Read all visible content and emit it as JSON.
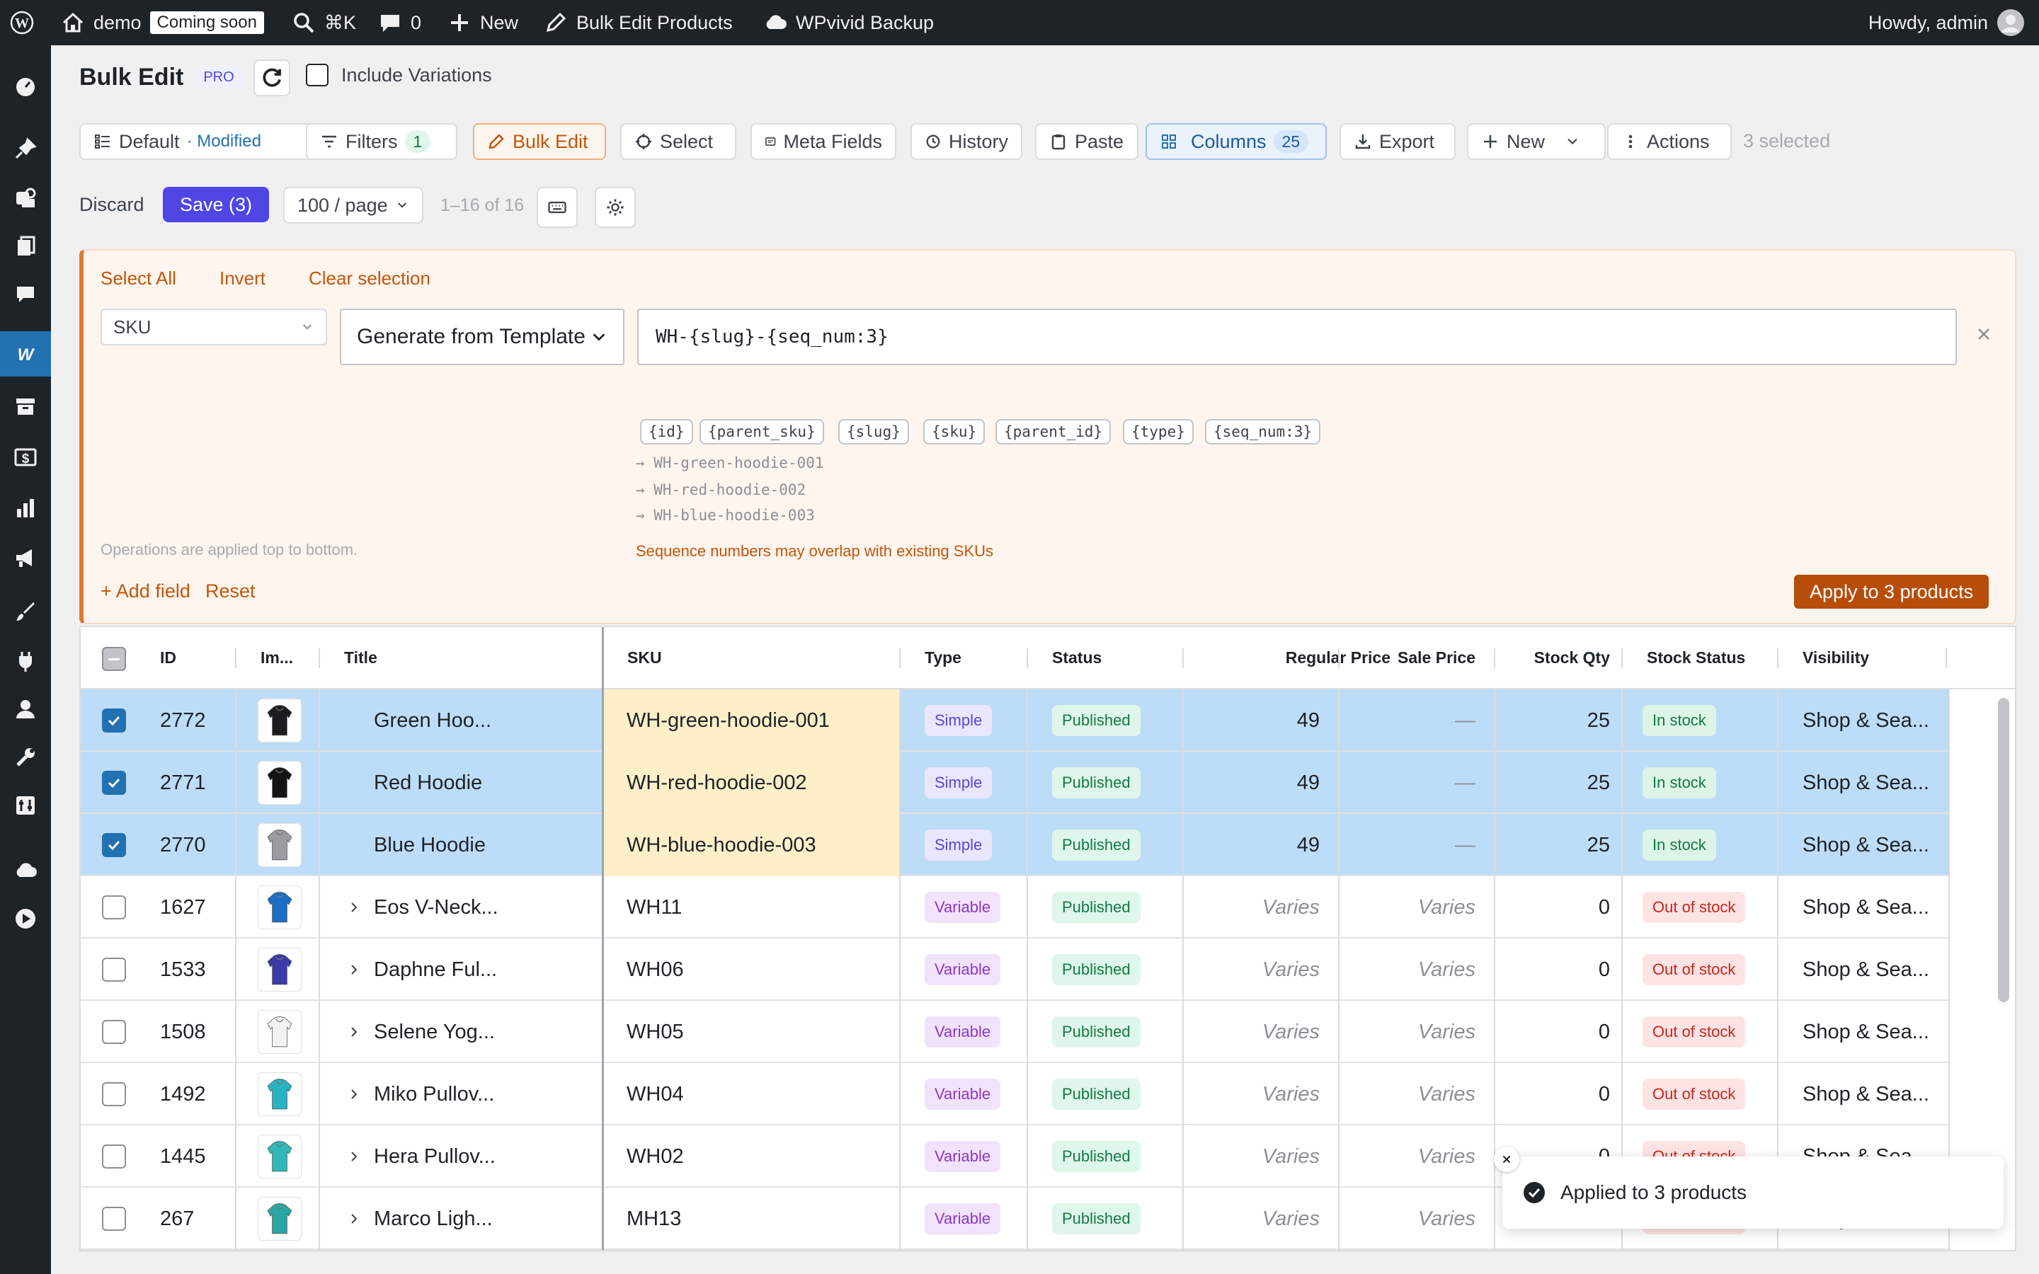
{
  "adminbar": {
    "site_name": "demo",
    "coming_soon": "Coming soon",
    "search_shortcut": "⌘K",
    "comments_count": "0",
    "new_label": "New",
    "bulk_edit_link": "Bulk Edit Products",
    "backup_link": "WPvivid Backup",
    "howdy": "Howdy, admin"
  },
  "header": {
    "title": "Bulk Edit",
    "pro_badge": "PRO",
    "include_variations": "Include Variations"
  },
  "toolbar": {
    "view_label": "Default",
    "view_modified": "· Modified",
    "filters_label": "Filters",
    "filters_count": "1",
    "bulk_edit_label": "Bulk Edit",
    "select_label": "Select",
    "meta_fields_label": "Meta Fields",
    "history_label": "History",
    "paste_label": "Paste",
    "columns_label": "Columns",
    "columns_count": "25",
    "export_label": "Export",
    "new_label": "New",
    "actions_label": "Actions",
    "selected_text": "3 selected"
  },
  "toolbar2": {
    "discard_label": "Discard",
    "save_label": "Save (3)",
    "per_page": "100 / page",
    "range_text": "1–16 of 16"
  },
  "panel": {
    "select_all": "Select All",
    "invert": "Invert",
    "clear_selection": "Clear selection",
    "field_select": "SKU",
    "mode_select": "Generate from Template",
    "template_value": "WH-{slug}-{seq_num:3}",
    "tokens": [
      "{id}",
      "{parent_sku}",
      "{slug}",
      "{sku}",
      "{parent_id}",
      "{type}",
      "{seq_num:3}"
    ],
    "previews": [
      "→ WH-green-hoodie-001",
      "→ WH-red-hoodie-002",
      "→ WH-blue-hoodie-003"
    ],
    "warning": "Sequence numbers may overlap with existing SKUs",
    "ops_note": "Operations are applied top to bottom.",
    "add_field": "+ Add field",
    "reset": "Reset",
    "apply_label": "Apply to 3 products"
  },
  "table": {
    "columns": [
      "ID",
      "Im...",
      "Title",
      "SKU",
      "Type",
      "Status",
      "Regular Price",
      "Sale Price",
      "Stock Qty",
      "Stock Status",
      "Visibility"
    ],
    "rows": [
      {
        "id": "2772",
        "title": "Green Hoo...",
        "sku": "WH-green-hoodie-001",
        "type": "Simple",
        "status": "Published",
        "regular": "49",
        "sale": "—",
        "qty": "25",
        "stock": "In stock",
        "visibility": "Shop & Sea...",
        "selected": true,
        "expandable": false,
        "shirt": "#1c1c1e"
      },
      {
        "id": "2771",
        "title": "Red Hoodie",
        "sku": "WH-red-hoodie-002",
        "type": "Simple",
        "status": "Published",
        "regular": "49",
        "sale": "—",
        "qty": "25",
        "stock": "In stock",
        "visibility": "Shop & Sea...",
        "selected": true,
        "expandable": false,
        "shirt": "#141414"
      },
      {
        "id": "2770",
        "title": "Blue Hoodie",
        "sku": "WH-blue-hoodie-003",
        "type": "Simple",
        "status": "Published",
        "regular": "49",
        "sale": "—",
        "qty": "25",
        "stock": "In stock",
        "visibility": "Shop & Sea...",
        "selected": true,
        "expandable": false,
        "shirt": "#9a9ca1"
      },
      {
        "id": "1627",
        "title": "Eos V-Neck...",
        "sku": "WH11",
        "type": "Variable",
        "status": "Published",
        "regular": "Varies",
        "sale": "Varies",
        "qty": "0",
        "stock": "Out of stock",
        "visibility": "Shop & Sea...",
        "selected": false,
        "expandable": true,
        "shirt": "#1a6fc4"
      },
      {
        "id": "1533",
        "title": "Daphne Ful...",
        "sku": "WH06",
        "type": "Variable",
        "status": "Published",
        "regular": "Varies",
        "sale": "Varies",
        "qty": "0",
        "stock": "Out of stock",
        "visibility": "Shop & Sea...",
        "selected": false,
        "expandable": true,
        "shirt": "#3b3aa8"
      },
      {
        "id": "1508",
        "title": "Selene Yog...",
        "sku": "WH05",
        "type": "Variable",
        "status": "Published",
        "regular": "Varies",
        "sale": "Varies",
        "qty": "0",
        "stock": "Out of stock",
        "visibility": "Shop & Sea...",
        "selected": false,
        "expandable": true,
        "shirt": "#f2f2f2"
      },
      {
        "id": "1492",
        "title": "Miko Pullov...",
        "sku": "WH04",
        "type": "Variable",
        "status": "Published",
        "regular": "Varies",
        "sale": "Varies",
        "qty": "0",
        "stock": "Out of stock",
        "visibility": "Shop & Sea...",
        "selected": false,
        "expandable": true,
        "shirt": "#27b3c2"
      },
      {
        "id": "1445",
        "title": "Hera Pullov...",
        "sku": "WH02",
        "type": "Variable",
        "status": "Published",
        "regular": "Varies",
        "sale": "Varies",
        "qty": "0",
        "stock": "Out of stock",
        "visibility": "Shop & Sea...",
        "selected": false,
        "expandable": true,
        "shirt": "#2fb8b8"
      },
      {
        "id": "267",
        "title": "Marco Ligh...",
        "sku": "MH13",
        "type": "Variable",
        "status": "Published",
        "regular": "Varies",
        "sale": "Varies",
        "qty": "0",
        "stock": "Out of stock",
        "visibility": "Shop & Sea...",
        "selected": false,
        "expandable": true,
        "shirt": "#2aa6a6"
      }
    ]
  },
  "toast": {
    "message": "Applied to 3 products"
  },
  "colors": {
    "accent": "#2271b1",
    "save": "#4f46e5",
    "panel_bg": "#fef5ee",
    "panel_accent": "#c2560a",
    "apply_bg": "#b84d0a",
    "selected_row": "#bddcf7",
    "sku_highlight": "#fdefc8"
  }
}
